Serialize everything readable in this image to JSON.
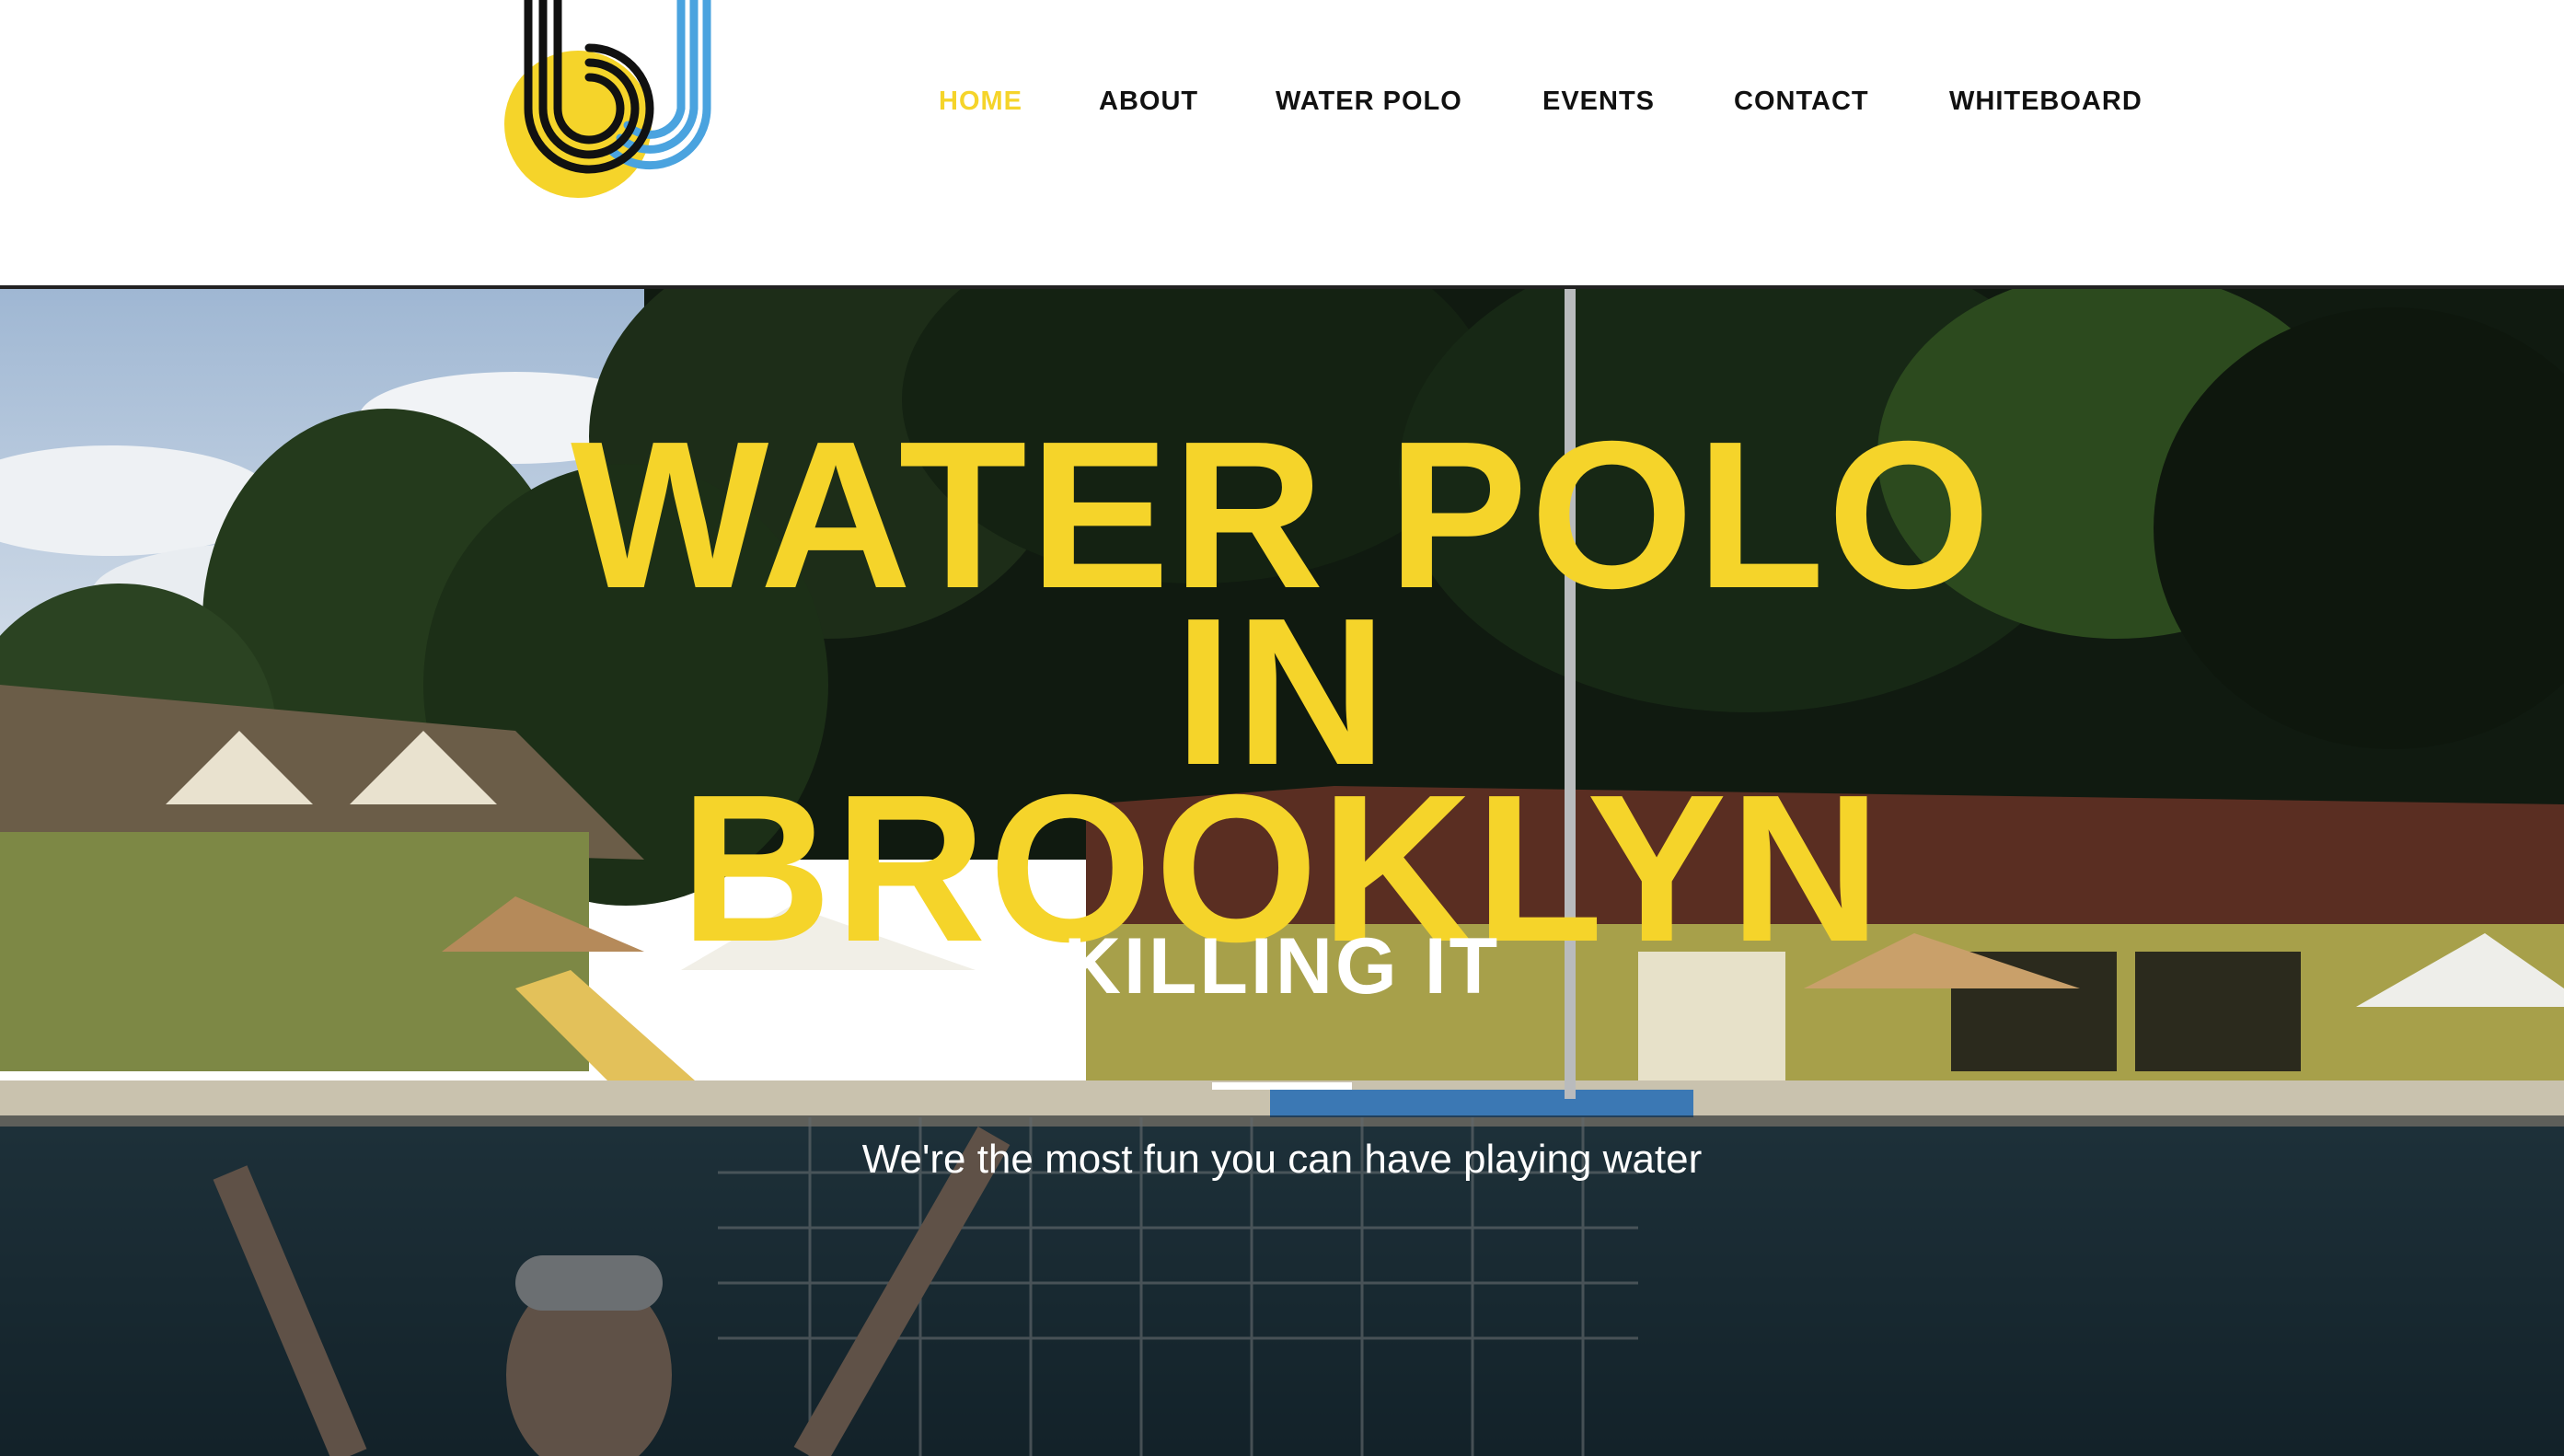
{
  "brand": {
    "logo_icon": "bj-logo-icon",
    "colors": {
      "yellow": "#f5d42a",
      "blue": "#4aa3df",
      "black": "#111111"
    }
  },
  "nav": {
    "items": [
      {
        "label": "HOME",
        "active": true
      },
      {
        "label": "ABOUT",
        "active": false
      },
      {
        "label": "WATER POLO",
        "active": false
      },
      {
        "label": "EVENTS",
        "active": false
      },
      {
        "label": "CONTACT",
        "active": false
      },
      {
        "label": "WHITEBOARD",
        "active": false
      }
    ]
  },
  "hero": {
    "title_lines": [
      "WATER POLO",
      "IN",
      "BROOKLYN"
    ],
    "title_color": "#f5d42a"
  },
  "band": {
    "title": "KILLING IT",
    "text": "We're the most fun you can have playing water"
  }
}
